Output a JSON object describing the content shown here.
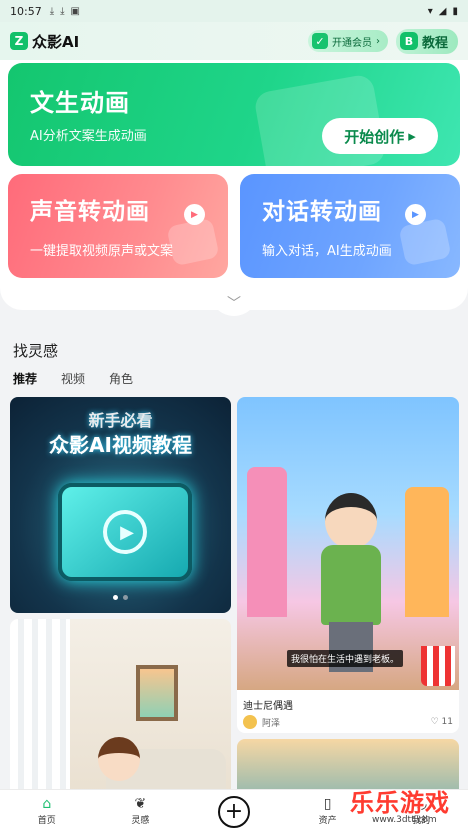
{
  "status": {
    "time": "10:57",
    "icons": [
      "download-icon",
      "download-icon",
      "app-icon"
    ],
    "right_icons": [
      "wifi-icon",
      "signal-icon",
      "battery-icon"
    ]
  },
  "header": {
    "app_name": "众影AI",
    "vip_label": "开通会员",
    "tutorial_label": "教程"
  },
  "hero": {
    "title": "文生动画",
    "subtitle": "AI分析文案生成动画",
    "button": "开始创作"
  },
  "cards": [
    {
      "title": "声音转动画",
      "subtitle": "一键提取视频原声或文案"
    },
    {
      "title": "对话转动画",
      "subtitle": "输入对话，AI生成动画"
    }
  ],
  "inspiration": {
    "title": "找灵感",
    "filters": [
      "推荐",
      "视频",
      "角色"
    ]
  },
  "feed": [
    {
      "title_top": "新手必看",
      "title_main": "众影AI视频教程"
    },
    {
      "subtitle": "我很怕在生活中遇到老板。",
      "caption": "迪士尼偶遇",
      "author": "阿泽",
      "likes": "11"
    }
  ],
  "tabbar": {
    "home": "首页",
    "inspiration": "灵感",
    "assets": "资产",
    "mine": "我的"
  },
  "watermark": {
    "text": "乐乐游戏",
    "url": "www.3dtt.com"
  },
  "colors": {
    "brand_green": "#14c66f",
    "red_card": "#ff6b7a",
    "blue_card": "#5a95ff"
  }
}
